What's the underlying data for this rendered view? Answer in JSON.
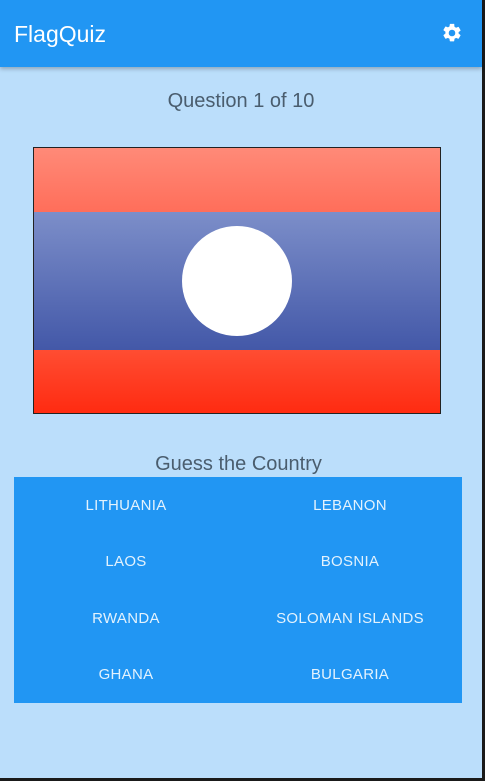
{
  "appbar": {
    "title": "FlagQuiz",
    "settings_icon": "gear-icon"
  },
  "quiz": {
    "question_label": "Question 1 of 10",
    "flag_country": "Laos",
    "guess_label": "Guess the Country",
    "answers": [
      "LITHUANIA",
      "LEBANON",
      "LAOS",
      "BOSNIA",
      "RWANDA",
      "SOLOMAN ISLANDS",
      "GHANA",
      "BULGARIA"
    ]
  },
  "colors": {
    "primary": "#2196f3",
    "background": "#bbdefb"
  }
}
